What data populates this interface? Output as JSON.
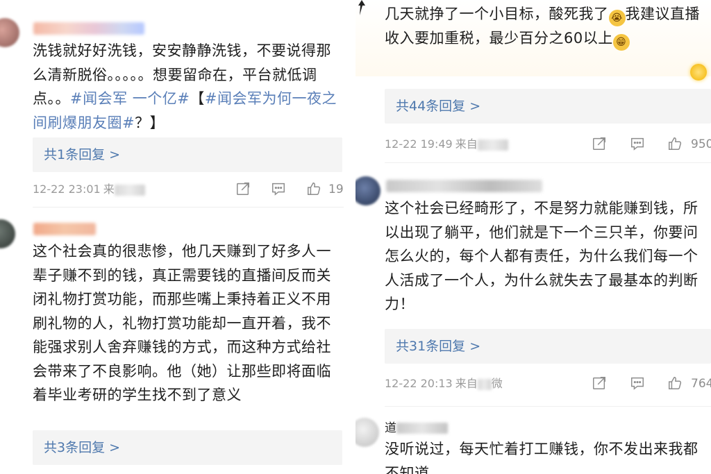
{
  "left": {
    "comment1": {
      "text_parts": [
        "洗钱就好好洗钱，安安静静洗钱，不要说得那么清新脱俗。。。。。想要留命在，平台就低调点。。",
        "#闻会军 一个亿#",
        "【",
        "#闻会军为何一夜之间刷爆朋友圈#",
        "？】"
      ],
      "reply_label": "共1条回复 >",
      "time": "12-22 23:01",
      "source_prefix": "来",
      "like_count": "19"
    },
    "comment2": {
      "text": "这个社会真的很悲惨，他几天赚到了好多人一辈子赚不到的钱，真正需要钱的直播间反而关闭礼物打赏功能，而那些嘴上秉持着正义不用刷礼物的人，礼物打赏功能却一直开着，我不能强求别人舍弃赚钱的方式，而这种方式给社会带来了不良影响。他（她）让那些即将面临着毕业考研的学生找不到了意义",
      "reply_label": "共3条回复 >"
    }
  },
  "right": {
    "comment1": {
      "text_a": "几天就挣了一个小目标，酸死我了",
      "emoji_a": "😭",
      "text_b": "我建议直播收入要加重税，最少百分之60以上",
      "emoji_b": "😁",
      "reply_label": "共44条回复 >",
      "time": "12-22 19:49",
      "source_prefix": "来自",
      "like_count": "950"
    },
    "comment2": {
      "text": "这个社会已经畸形了，不是努力就能赚到钱，所以出现了躺平，他们就是下一个三只羊，你要问怎么火的，每个人都有责任，为什么我们每一个人活成了一个人，为什么就失去了最基本的判断力！",
      "reply_label": "共31条回复 >",
      "time": "12-22 20:13",
      "source_prefix": "来自",
      "source_suffix": "微",
      "like_count": "764"
    },
    "comment3": {
      "username_prefix": "道",
      "text": "没听说过，每天忙着打工赚钱，你不发出来我都不知道"
    }
  },
  "colors": {
    "link": "#4e78ad",
    "hashtag": "#5a7fb8",
    "meta": "#9a9a9a",
    "reply_bg": "#f4f4f4"
  },
  "icons": [
    "share-icon",
    "comment-icon",
    "like-icon"
  ]
}
